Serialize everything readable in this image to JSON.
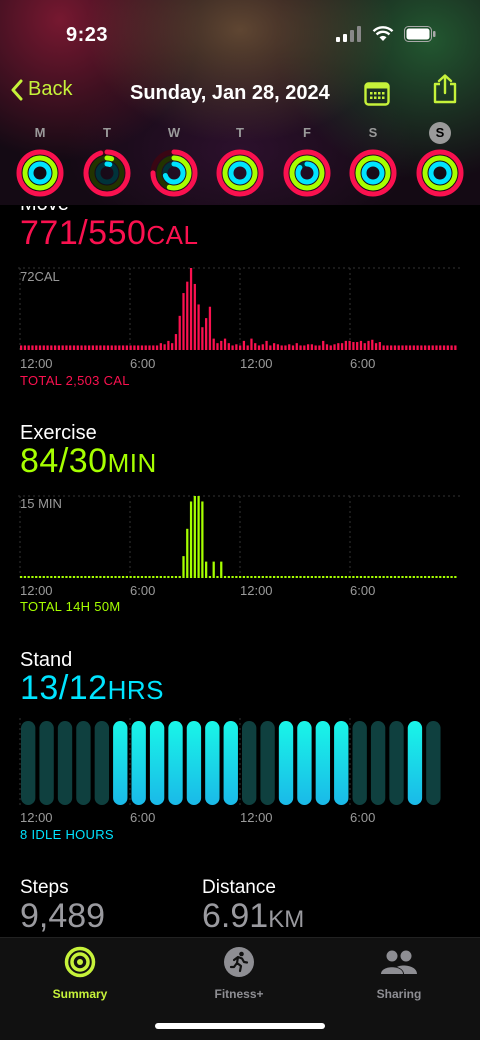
{
  "status": {
    "time": "9:23"
  },
  "nav": {
    "back_label": "Back",
    "title": "Sunday, Jan 28, 2024"
  },
  "days": [
    {
      "letter": "M",
      "move": 1.15,
      "exercise": 1.8,
      "stand": 1.0,
      "selected": false
    },
    {
      "letter": "T",
      "move": 0.95,
      "exercise": 0.05,
      "stand": 0.05,
      "selected": false
    },
    {
      "letter": "W",
      "move": 0.75,
      "exercise": 0.55,
      "stand": 0.7,
      "selected": false
    },
    {
      "letter": "T",
      "move": 1.1,
      "exercise": 1.6,
      "stand": 1.0,
      "selected": false
    },
    {
      "letter": "F",
      "move": 1.0,
      "exercise": 1.2,
      "stand": 0.85,
      "selected": false
    },
    {
      "letter": "S",
      "move": 1.05,
      "exercise": 1.5,
      "stand": 1.0,
      "selected": false
    },
    {
      "letter": "S",
      "move": 1.4,
      "exercise": 2.8,
      "stand": 1.08,
      "selected": true
    }
  ],
  "move": {
    "title": "Move",
    "value": "771/550",
    "unit": "CAL",
    "max_label": "72CAL",
    "total": "TOTAL 2,503 CAL",
    "color": "#fa114f"
  },
  "exercise": {
    "title": "Exercise",
    "value": "84/30",
    "unit": "MIN",
    "max_label": "15 MIN",
    "total": "TOTAL 14H 50M",
    "color": "#a6ff00"
  },
  "stand": {
    "title": "Stand",
    "value": "13/12",
    "unit": "HRS",
    "total": "8 IDLE HOURS",
    "color": "#00f0ff"
  },
  "axis_ticks": [
    "12:00",
    "6:00",
    "12:00",
    "6:00"
  ],
  "steps": {
    "label": "Steps",
    "value": "9,489"
  },
  "distance": {
    "label": "Distance",
    "value": "6.91",
    "unit": "KM"
  },
  "tabs": [
    {
      "label": "Summary",
      "active": true
    },
    {
      "label": "Fitness+",
      "active": false
    },
    {
      "label": "Sharing",
      "active": false
    }
  ],
  "chart_data": [
    {
      "type": "bar",
      "series": [
        {
          "name": "Move",
          "values": [
            4,
            4,
            4,
            4,
            4,
            4,
            4,
            4,
            4,
            4,
            4,
            4,
            4,
            4,
            4,
            4,
            4,
            4,
            4,
            4,
            4,
            4,
            4,
            4,
            4,
            4,
            4,
            4,
            4,
            4,
            4,
            4,
            4,
            4,
            4,
            4,
            4,
            6,
            5,
            8,
            6,
            14,
            30,
            50,
            60,
            72,
            58,
            40,
            20,
            28,
            38,
            10,
            6,
            8,
            10,
            6,
            4,
            5,
            4,
            8,
            4,
            10,
            6,
            4,
            5,
            8,
            4,
            6,
            5,
            4,
            4,
            5,
            4,
            6,
            4,
            4,
            5,
            5,
            4,
            4,
            8,
            5,
            4,
            5,
            6,
            6,
            8,
            8,
            7,
            7,
            8,
            6,
            8,
            9,
            6,
            7,
            4,
            4,
            4,
            4,
            4,
            4,
            4,
            4,
            4,
            4,
            4,
            4,
            4,
            4,
            4,
            4,
            4,
            4,
            4,
            4
          ]
        }
      ],
      "ylim": [
        0,
        72
      ]
    },
    {
      "type": "bar",
      "series": [
        {
          "name": "Exercise",
          "values": [
            0,
            0,
            0,
            0,
            0,
            0,
            0,
            0,
            0,
            0,
            0,
            0,
            0,
            0,
            0,
            0,
            0,
            0,
            0,
            0,
            0,
            0,
            0,
            0,
            0,
            0,
            0,
            0,
            0,
            0,
            0,
            0,
            0,
            0,
            0,
            0,
            0,
            0,
            0,
            0,
            0,
            0,
            0,
            4,
            9,
            14,
            15,
            15,
            14,
            3,
            0,
            3,
            0,
            3,
            0,
            0,
            0,
            0,
            0,
            0,
            0,
            0,
            0,
            0,
            0,
            0,
            0,
            0,
            0,
            0,
            0,
            0,
            0,
            0,
            0,
            0,
            0,
            0,
            0,
            0,
            0,
            0,
            0,
            0,
            0,
            0,
            0,
            0,
            0,
            0,
            0,
            0,
            0,
            0,
            0,
            0,
            0,
            0,
            0,
            0,
            0,
            0,
            0,
            0,
            0,
            0,
            0,
            0,
            0,
            0,
            0,
            0,
            0,
            0,
            0,
            0
          ]
        }
      ],
      "ylim": [
        0,
        15
      ]
    },
    {
      "type": "bar",
      "series": [
        {
          "name": "Stand",
          "values": [
            0,
            0,
            0,
            0,
            0,
            1,
            1,
            1,
            1,
            1,
            1,
            1,
            0,
            0,
            1,
            1,
            1,
            1,
            0,
            0,
            0,
            1,
            0
          ]
        }
      ]
    }
  ]
}
